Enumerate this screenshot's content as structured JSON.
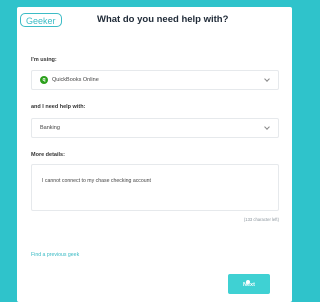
{
  "header": {
    "logo_text": "Geeker",
    "title": "What do you need help with?"
  },
  "form": {
    "software_label": "I'm using:",
    "software_value": "QuickBooks Online",
    "software_icon": "quickbooks-icon",
    "help_label": "and I need help with:",
    "help_value": "Banking",
    "details_label": "More details:",
    "details_value": "I cannot connect to my chase checking account",
    "char_counter": "(133 character left)"
  },
  "footer": {
    "previous_geek_link": "Find a previous geek",
    "next_button": "Next"
  },
  "colors": {
    "background": "#2fc3cb",
    "accent": "#3cbcc6",
    "button": "#3fd1d3",
    "quickbooks_green": "#2ca01c"
  }
}
